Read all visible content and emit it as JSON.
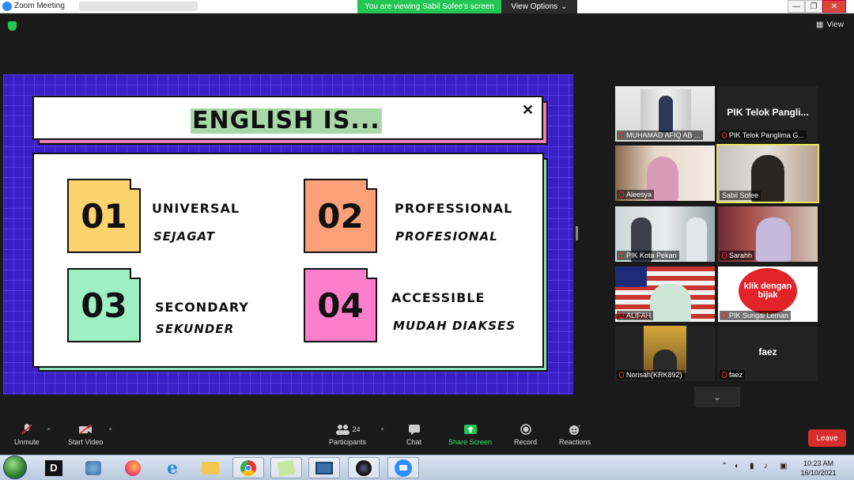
{
  "window": {
    "app_title": "Zoom Meeting",
    "viewing_banner": "You are viewing Sabil Sofee's screen",
    "view_options": "View Options",
    "view_button": "View",
    "controls": {
      "minimize": "—",
      "restore": "❐",
      "close": "✕"
    }
  },
  "slide": {
    "title": "ENGLISH IS...",
    "close_glyph": "✕",
    "items": [
      {
        "number": "01",
        "english": "UNIVERSAL",
        "malay": "SEJAGAT",
        "color": "#fdd36e"
      },
      {
        "number": "02",
        "english": "PROFESSIONAL",
        "malay": "PROFESIONAL",
        "color": "#fca07a"
      },
      {
        "number": "03",
        "english": "SECONDARY",
        "malay": "SEKUNDER",
        "color": "#9ef0c4"
      },
      {
        "number": "04",
        "english": "ACCESSIBLE",
        "malay": "MUDAH DIAKSES",
        "color": "#fd7fcc"
      }
    ]
  },
  "participants_gallery": [
    {
      "name": "MUHAMAD AFIQ AB ...",
      "muted": true,
      "video": true
    },
    {
      "name": "PIK Telok Panglima G...",
      "big_name": "PIK Telok Pangli...",
      "muted": true,
      "video": false
    },
    {
      "name": "Aleesya",
      "muted": true,
      "video": true
    },
    {
      "name": "Sabil Sofee",
      "muted": false,
      "video": true,
      "active_speaker": true
    },
    {
      "name": "PIK Kota Pekan",
      "muted": true,
      "video": true
    },
    {
      "name": "Sarahh",
      "muted": true,
      "video": true
    },
    {
      "name": "ALIFAH",
      "muted": true,
      "video": true
    },
    {
      "name": "PIK Sungai Leman",
      "muted": true,
      "video": true,
      "logo_text": "klik dengan bijak"
    },
    {
      "name": "Norisah(KRK892)",
      "muted": true,
      "video": true
    },
    {
      "name": "faez",
      "big_name": "faez",
      "muted": true,
      "video": false
    }
  ],
  "toolbar": {
    "unmute": "Unmute",
    "start_video": "Start Video",
    "participants": "Participants",
    "participants_count": "24",
    "chat": "Chat",
    "share_screen": "Share Screen",
    "record": "Record",
    "reactions": "Reactions",
    "leave": "Leave"
  },
  "taskbar": {
    "time": "10:23 AM",
    "date": "16/10/2021",
    "apps": [
      "start-orb",
      "dp-app",
      "network-app",
      "firefox",
      "internet-explorer",
      "file-explorer",
      "chrome",
      "notes",
      "remote-desktop",
      "camera",
      "zoom"
    ]
  },
  "colors": {
    "accent_green": "#23c553",
    "leave_red": "#d82d2d",
    "slide_bg": "#3b1fc6",
    "active_speaker_border": "#e6e65a"
  }
}
